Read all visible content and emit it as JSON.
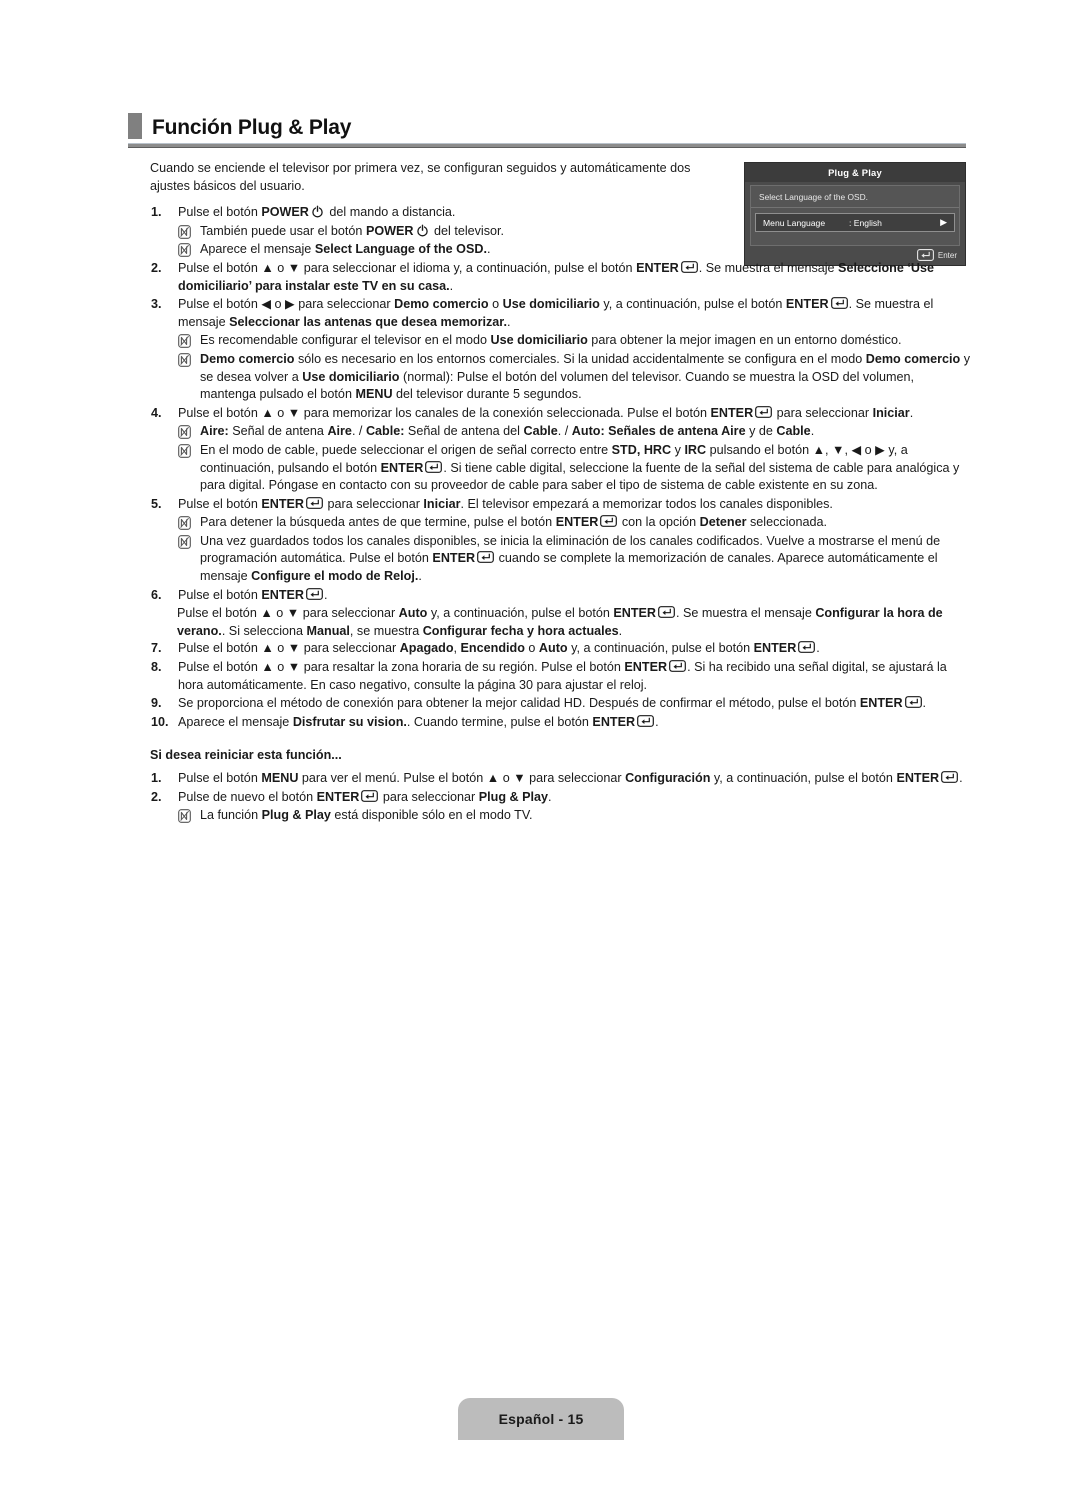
{
  "header": {
    "title": "Función Plug & Play"
  },
  "intro": "Cuando se enciende el televisor por primera vez, se configuran seguidos y automáticamente dos ajustes básicos del usuario.",
  "osd": {
    "title": "Plug & Play",
    "prompt": "Select Language of the OSD.",
    "row_label": "Menu Language",
    "row_value": ": English",
    "row_arrow": "▶",
    "footer_label": "Enter",
    "footer_icon": "enter-icon"
  },
  "steps": [
    {
      "num": "1.",
      "parts": [
        {
          "t": "Pulse el botón "
        },
        {
          "t": "POWER",
          "b": true
        },
        {
          "icon": "power-icon"
        },
        {
          "t": " del mando a distancia."
        }
      ],
      "notes": [
        {
          "parts": [
            {
              "t": "También puede usar el botón "
            },
            {
              "t": "POWER",
              "b": true
            },
            {
              "icon": "power-icon"
            },
            {
              "t": " del televisor."
            }
          ]
        },
        {
          "parts": [
            {
              "t": "Aparece el mensaje "
            },
            {
              "t": "Select Language of the OSD.",
              "b": true
            },
            {
              "t": "."
            }
          ]
        }
      ]
    },
    {
      "num": "2.",
      "parts": [
        {
          "t": "Pulse el botón ▲ o ▼ para seleccionar el idioma y, a continuación, pulse el botón "
        },
        {
          "t": "ENTER",
          "b": true
        },
        {
          "icon": "enter-icon"
        },
        {
          "t": ". Se muestra el mensaje "
        },
        {
          "t": "Seleccione ‘Use domiciliario’ para instalar este TV en su casa.",
          "b": true
        },
        {
          "t": "."
        }
      ],
      "notes": []
    },
    {
      "num": "3.",
      "parts": [
        {
          "t": "Pulse el botón ◀ o ▶ para seleccionar "
        },
        {
          "t": "Demo comercio",
          "b": true
        },
        {
          "t": " o "
        },
        {
          "t": "Use domiciliario",
          "b": true
        },
        {
          "t": " y, a continuación, pulse el botón "
        },
        {
          "t": "ENTER",
          "b": true
        },
        {
          "icon": "enter-icon"
        },
        {
          "t": ". Se muestra el mensaje "
        },
        {
          "t": "Seleccionar las antenas que desea memorizar.",
          "b": true
        },
        {
          "t": "."
        }
      ],
      "notes": [
        {
          "parts": [
            {
              "t": "Es recomendable configurar el televisor en el modo "
            },
            {
              "t": "Use domiciliario",
              "b": true
            },
            {
              "t": " para obtener la mejor imagen en un entorno doméstico."
            }
          ]
        },
        {
          "parts": [
            {
              "t": "Demo comercio",
              "b": true
            },
            {
              "t": " sólo es necesario en los entornos comerciales. Si la unidad accidentalmente se configura en el modo "
            },
            {
              "t": "Demo comercio",
              "b": true
            },
            {
              "t": " y se desea volver a "
            },
            {
              "t": "Use domiciliario",
              "b": true
            },
            {
              "t": " (normal): Pulse el botón del volumen del televisor. Cuando se muestra la OSD del volumen, mantenga pulsado el botón "
            },
            {
              "t": "MENU",
              "b": true
            },
            {
              "t": " del televisor durante 5 segundos."
            }
          ]
        }
      ]
    },
    {
      "num": "4.",
      "parts": [
        {
          "t": "Pulse el botón ▲ o ▼ para memorizar los canales de la conexión seleccionada. Pulse el botón "
        },
        {
          "t": "ENTER",
          "b": true
        },
        {
          "icon": "enter-icon"
        },
        {
          "t": " para seleccionar "
        },
        {
          "t": "Iniciar",
          "b": true
        },
        {
          "t": "."
        }
      ],
      "notes": [
        {
          "parts": [
            {
              "t": "Aire:",
              "b": true
            },
            {
              "t": " Señal de antena "
            },
            {
              "t": "Aire",
              "b": true
            },
            {
              "t": ". / "
            },
            {
              "t": "Cable:",
              "b": true
            },
            {
              "t": " Señal de antena del "
            },
            {
              "t": "Cable",
              "b": true
            },
            {
              "t": ". / "
            },
            {
              "t": "Auto: Señales de antena Aire",
              "b": true
            },
            {
              "t": " y de "
            },
            {
              "t": "Cable",
              "b": true
            },
            {
              "t": "."
            }
          ]
        },
        {
          "parts": [
            {
              "t": "En el modo de cable, puede seleccionar el origen de señal correcto entre "
            },
            {
              "t": "STD, HRC",
              "b": true
            },
            {
              "t": " y "
            },
            {
              "t": "IRC",
              "b": true
            },
            {
              "t": " pulsando el botón ▲, ▼, ◀ o ▶ y, a continuación, pulsando el botón "
            },
            {
              "t": "ENTER",
              "b": true
            },
            {
              "icon": "enter-icon"
            },
            {
              "t": ". Si tiene cable digital, seleccione la fuente de la señal del sistema de cable para analógica y para digital. Póngase en contacto con su proveedor de cable para saber el tipo de sistema de cable existente en su zona."
            }
          ]
        }
      ]
    },
    {
      "num": "5.",
      "parts": [
        {
          "t": "Pulse el botón "
        },
        {
          "t": "ENTER",
          "b": true
        },
        {
          "icon": "enter-icon"
        },
        {
          "t": " para seleccionar "
        },
        {
          "t": "Iniciar",
          "b": true
        },
        {
          "t": ". El televisor empezará a memorizar todos los canales disponibles."
        }
      ],
      "notes": [
        {
          "parts": [
            {
              "t": "Para detener la búsqueda antes de que termine, pulse el botón "
            },
            {
              "t": "ENTER",
              "b": true
            },
            {
              "icon": "enter-icon"
            },
            {
              "t": " con la opción "
            },
            {
              "t": "Detener",
              "b": true
            },
            {
              "t": " seleccionada."
            }
          ]
        },
        {
          "parts": [
            {
              "t": "Una vez guardados todos los canales disponibles, se inicia la eliminación de los canales codificados. Vuelve a mostrarse el menú de programación automática. Pulse el botón "
            },
            {
              "t": "ENTER",
              "b": true
            },
            {
              "icon": "enter-icon"
            },
            {
              "t": " cuando se complete la memorización de canales. Aparece automáticamente el mensaje "
            },
            {
              "t": "Configure el modo de Reloj.",
              "b": true
            },
            {
              "t": "."
            }
          ]
        }
      ]
    },
    {
      "num": "6.",
      "parts": [
        {
          "t": "Pulse el botón "
        },
        {
          "t": "ENTER",
          "b": true
        },
        {
          "icon": "enter-icon"
        },
        {
          "t": "."
        }
      ],
      "notes": [],
      "follow": {
        "parts": [
          {
            "t": "Pulse el botón ▲ o ▼ para seleccionar "
          },
          {
            "t": "Auto",
            "b": true
          },
          {
            "t": " y, a continuación, pulse el botón "
          },
          {
            "t": "ENTER",
            "b": true
          },
          {
            "icon": "enter-icon"
          },
          {
            "t": ". Se muestra el mensaje "
          },
          {
            "t": "Configurar la hora de verano.",
            "b": true
          },
          {
            "t": ". Si selecciona "
          },
          {
            "t": "Manual",
            "b": true
          },
          {
            "t": ", se muestra "
          },
          {
            "t": "Configurar fecha y hora actuales",
            "b": true
          },
          {
            "t": "."
          }
        ]
      }
    },
    {
      "num": "7.",
      "parts": [
        {
          "t": "Pulse el botón ▲ o ▼ para seleccionar "
        },
        {
          "t": "Apagado",
          "b": true
        },
        {
          "t": ", "
        },
        {
          "t": "Encendido",
          "b": true
        },
        {
          "t": " o "
        },
        {
          "t": "Auto",
          "b": true
        },
        {
          "t": " y, a continuación, pulse el botón "
        },
        {
          "t": "ENTER",
          "b": true
        },
        {
          "icon": "enter-icon"
        },
        {
          "t": "."
        }
      ],
      "notes": []
    },
    {
      "num": "8.",
      "parts": [
        {
          "t": "Pulse el botón ▲ o ▼ para resaltar la zona horaria de su región. Pulse el botón "
        },
        {
          "t": "ENTER",
          "b": true
        },
        {
          "icon": "enter-icon"
        },
        {
          "t": ". Si ha recibido una señal digital, se ajustará la hora automáticamente. En caso negativo, consulte la página 30 para ajustar el reloj."
        }
      ],
      "notes": []
    },
    {
      "num": "9.",
      "parts": [
        {
          "t": "Se proporciona el método de conexión para obtener la mejor calidad HD. Después de confirmar el método, pulse el botón "
        },
        {
          "t": "ENTER",
          "b": true
        },
        {
          "icon": "enter-icon"
        },
        {
          "t": "."
        }
      ],
      "notes": []
    },
    {
      "num": "10.",
      "parts": [
        {
          "t": "Aparece el mensaje "
        },
        {
          "t": "Disfrutar su vision.",
          "b": true
        },
        {
          "t": ". Cuando termine, pulse el botón "
        },
        {
          "t": "ENTER",
          "b": true
        },
        {
          "icon": "enter-icon"
        },
        {
          "t": "."
        }
      ],
      "notes": []
    }
  ],
  "restart_section": {
    "heading": "Si desea reiniciar esta función...",
    "steps": [
      {
        "num": "1.",
        "parts": [
          {
            "t": "Pulse el botón "
          },
          {
            "t": "MENU",
            "b": true
          },
          {
            "t": " para ver el menú. Pulse el botón ▲ o ▼ para seleccionar "
          },
          {
            "t": "Configuración",
            "b": true
          },
          {
            "t": " y, a continuación, pulse el botón "
          },
          {
            "t": "ENTER",
            "b": true
          },
          {
            "icon": "enter-icon"
          },
          {
            "t": "."
          }
        ],
        "notes": []
      },
      {
        "num": "2.",
        "parts": [
          {
            "t": "Pulse de nuevo el botón "
          },
          {
            "t": "ENTER",
            "b": true
          },
          {
            "icon": "enter-icon"
          },
          {
            "t": " para seleccionar "
          },
          {
            "t": "Plug & Play",
            "b": true
          },
          {
            "t": "."
          }
        ],
        "notes": [
          {
            "parts": [
              {
                "t": "La función "
              },
              {
                "t": "Plug & Play",
                "b": true
              },
              {
                "t": " está disponible sólo en el modo TV."
              }
            ]
          }
        ]
      }
    ]
  },
  "footer": {
    "label": "Español - 15"
  },
  "colors": {
    "header_marker": "#808080",
    "rule": "#8c8c8c",
    "osd_bg": "#4b4b4b",
    "footer_tab": "#bcbcbc"
  }
}
